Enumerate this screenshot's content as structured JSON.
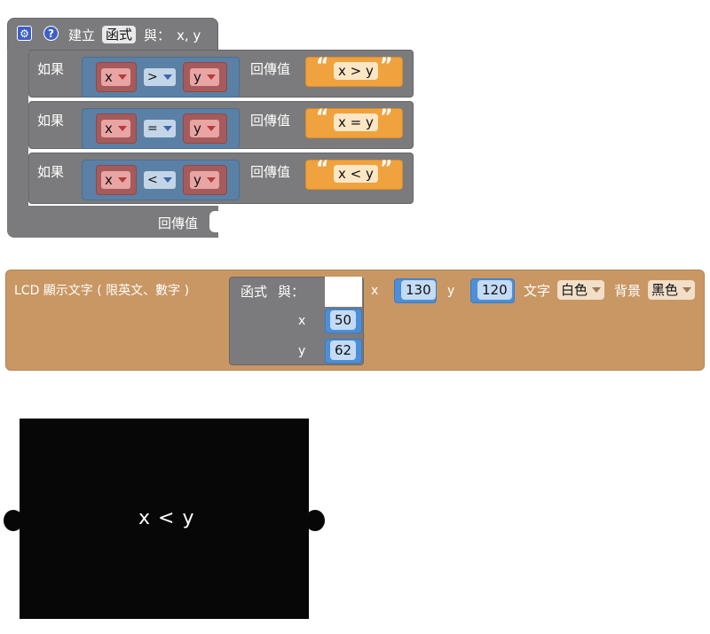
{
  "procedure": {
    "settings_icon": "gear-icon",
    "help_icon": "question-mark-icon",
    "create_label": "建立",
    "function_name": "函式",
    "with_label": "與：",
    "params": "x, y",
    "return_label": "回傳值",
    "branches": [
      {
        "if_label": "如果",
        "left_var": "x",
        "op": ">",
        "right_var": "y",
        "return_label": "回傳值",
        "string_value": "x > y"
      },
      {
        "if_label": "如果",
        "left_var": "x",
        "op": "=",
        "right_var": "y",
        "return_label": "回傳值",
        "string_value": "x = y"
      },
      {
        "if_label": "如果",
        "left_var": "x",
        "op": "<",
        "right_var": "y",
        "return_label": "回傳值",
        "string_value": "x < y"
      }
    ]
  },
  "lcd_block": {
    "label": "LCD 顯示文字 ( 限英文、數字 )",
    "call_name": "函式",
    "call_with": "與：",
    "arg_x_label": "x",
    "arg_x_value": "50",
    "arg_y_label": "y",
    "arg_y_value": "62",
    "pos_x_label": "x",
    "pos_x_value": "130",
    "pos_y_label": "y",
    "pos_y_value": "120",
    "text_color_label": "文字",
    "text_color_value": "白色",
    "bg_color_label": "背景",
    "bg_color_value": "黑色"
  },
  "lcd_screen": {
    "display_text": "x < y"
  },
  "colors": {
    "procedure": "#7b7b7d",
    "logic": "#5b80a5",
    "variable": "#a55b5b",
    "string": "#f0a23e",
    "math": "#4d8fd6",
    "lcd": "#c99764",
    "screen": "#070707"
  }
}
